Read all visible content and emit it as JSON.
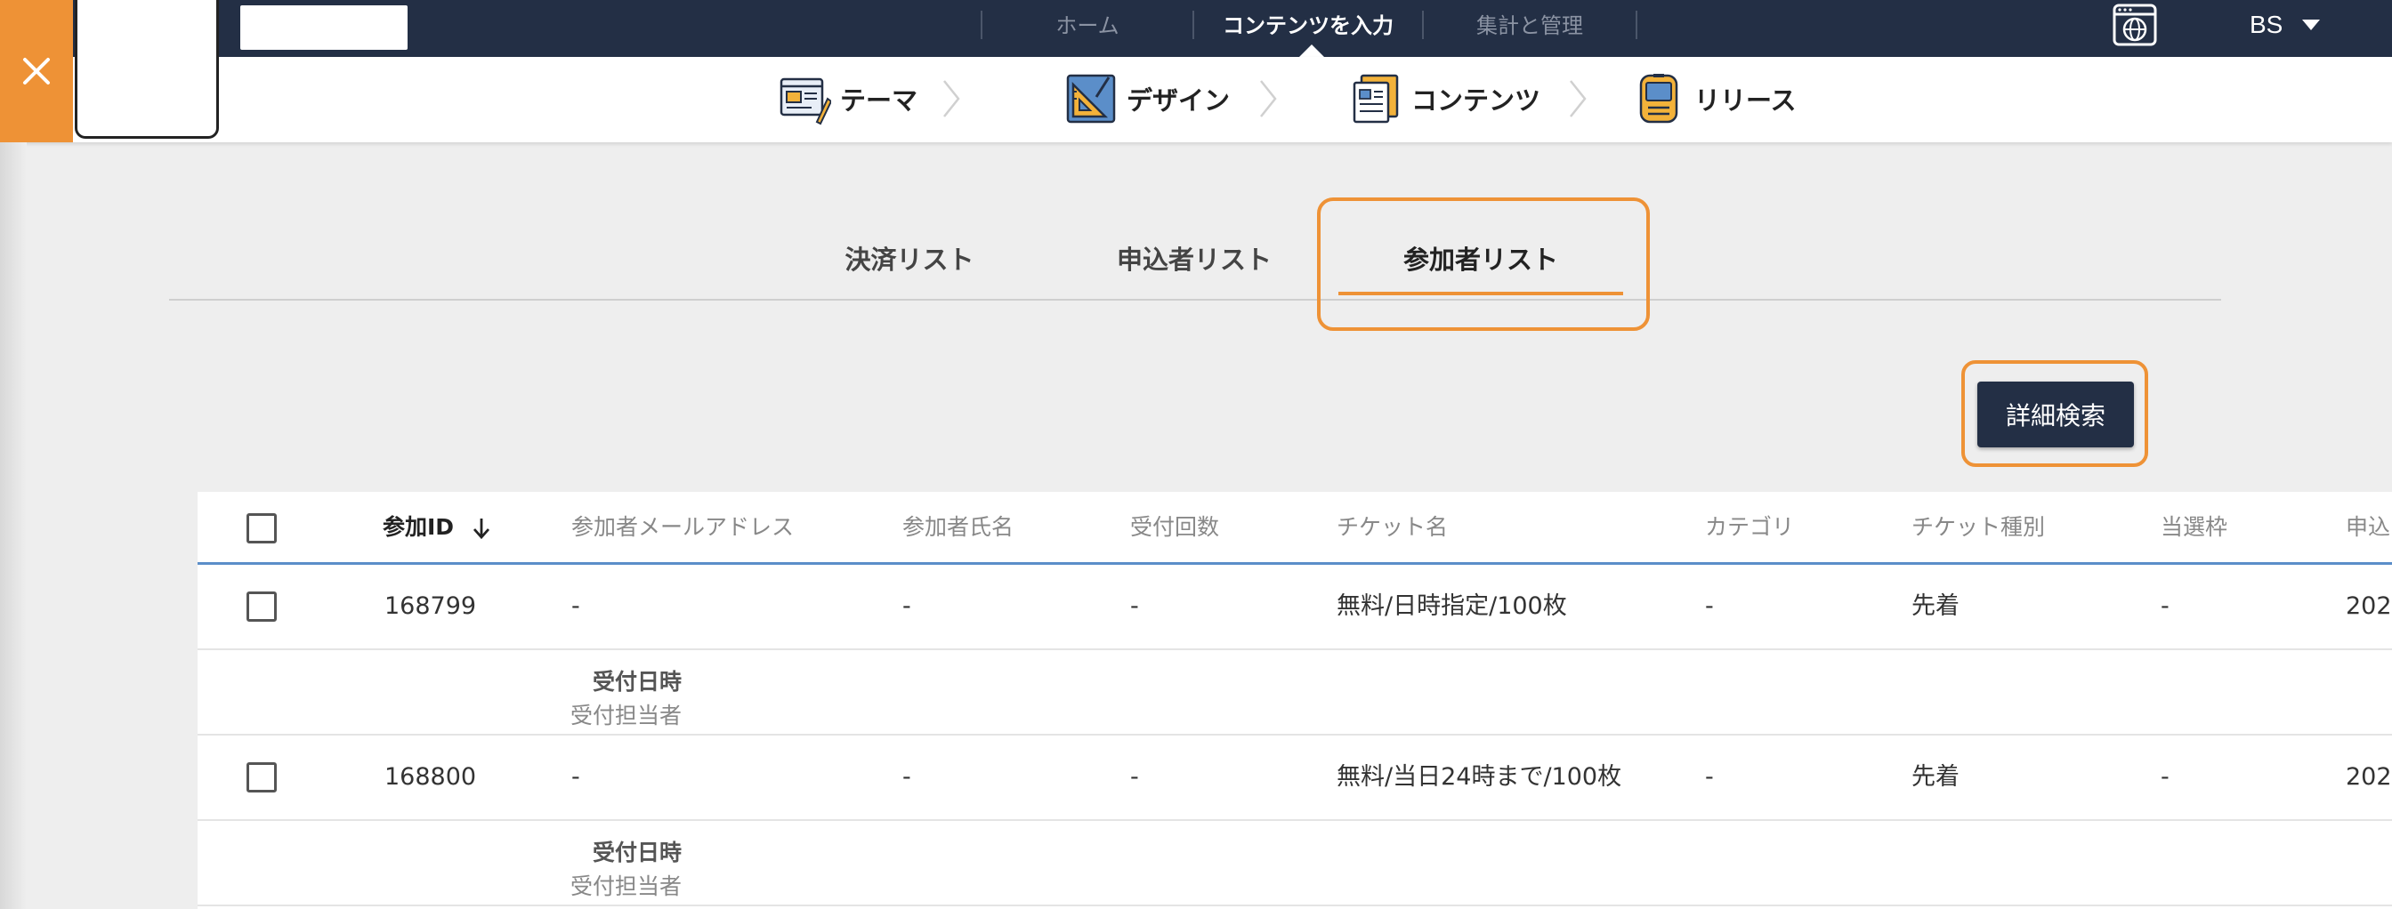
{
  "top_nav": {
    "items": [
      {
        "label": "ホーム"
      },
      {
        "label": "コンテンツを入力"
      },
      {
        "label": "集計と管理"
      }
    ],
    "user": "BS"
  },
  "steps": [
    {
      "label": "テーマ",
      "icon": "theme-icon"
    },
    {
      "label": "デザイン",
      "icon": "design-icon"
    },
    {
      "label": "コンテンツ",
      "icon": "contents-icon"
    },
    {
      "label": "リリース",
      "icon": "release-icon"
    }
  ],
  "tabs": [
    {
      "label": "決済リスト"
    },
    {
      "label": "申込者リスト"
    },
    {
      "label": "参加者リスト",
      "active": true
    }
  ],
  "search_button": "詳細検索",
  "table": {
    "columns": [
      "参加ID",
      "参加者メールアドレス",
      "参加者氏名",
      "受付回数",
      "チケット名",
      "カテゴリ",
      "チケット種別",
      "当選枠",
      "申込"
    ],
    "rows": [
      {
        "id": "168799",
        "email": "-",
        "name": "-",
        "count": "-",
        "ticket": "無料/日時指定/100枚",
        "category": "-",
        "type": "先着",
        "slot": "-",
        "applied": "202",
        "sub1": "受付日時",
        "sub2": "受付担当者"
      },
      {
        "id": "168800",
        "email": "-",
        "name": "-",
        "count": "-",
        "ticket": "無料/当日24時まで/100枚",
        "category": "-",
        "type": "先着",
        "slot": "-",
        "applied": "202",
        "sub1": "受付日時",
        "sub2": "受付担当者"
      }
    ]
  },
  "colors": {
    "navy": "#232f45",
    "accent_orange": "#ee9236",
    "header_underline": "#5b8ec9"
  }
}
